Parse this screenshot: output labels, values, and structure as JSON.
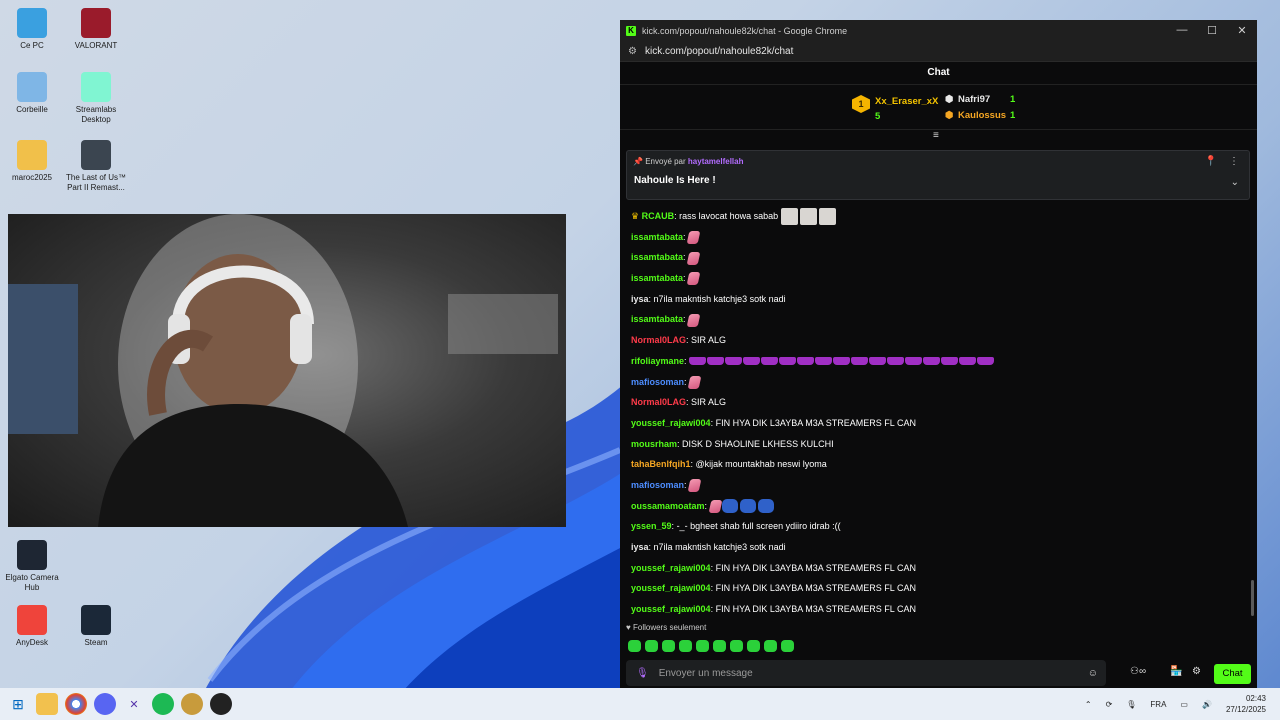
{
  "desktop": {
    "icons": [
      {
        "label": "Ce PC",
        "icon": "computer-icon",
        "color": "#3aa0e0"
      },
      {
        "label": "VALORANT",
        "icon": "valorant-icon",
        "color": "#9a1b2b"
      },
      {
        "label": "Corbeille",
        "icon": "recycle-bin-icon",
        "color": "#7fb6e6"
      },
      {
        "label": "Streamlabs Desktop",
        "icon": "streamlabs-icon",
        "color": "#80f5d2"
      },
      {
        "label": "maroc2025",
        "icon": "folder-icon",
        "color": "#f1c04a"
      },
      {
        "label": "The Last of Us™ Part II Remast...",
        "icon": "game-icon",
        "color": "#3b4550"
      },
      {
        "label": "Elgato Camera Hub",
        "icon": "elgato-icon",
        "color": "#1e2633"
      },
      {
        "label": "AnyDesk",
        "icon": "anydesk-icon",
        "color": "#ef443b"
      },
      {
        "label": "Steam",
        "icon": "steam-icon",
        "color": "#1b2838"
      }
    ]
  },
  "browser": {
    "title": "kick.com/popout/nahoule82k/chat - Google Chrome",
    "url": "kick.com/popout/nahoule82k/chat"
  },
  "chat": {
    "header": "Chat",
    "leaderboard": {
      "rank": "1",
      "first": {
        "name": "Xx_Eraser_xX",
        "count": "5"
      },
      "second": {
        "name": "Nafri97",
        "count": "1"
      },
      "third": {
        "name": "Kaulossus",
        "count": "1"
      }
    },
    "pinned": {
      "sent_by": "Envoyé par",
      "user": "haytamelfellah",
      "message": "Nahoule Is Here !"
    },
    "messages": [
      {
        "user": "RCAUB",
        "color": "#53fc18",
        "text": "rass lavocat howa sabab",
        "emotes": "pic3",
        "badge": "crown"
      },
      {
        "user": "issamtabata",
        "color": "#53fc18",
        "text": "",
        "emotes": "brush1"
      },
      {
        "user": "issamtabata",
        "color": "#53fc18",
        "text": "",
        "emotes": "brush1"
      },
      {
        "user": "issamtabata",
        "color": "#53fc18",
        "text": "",
        "emotes": "brush1"
      },
      {
        "user": "iysa",
        "color": "#e8e8e8",
        "text": "n7ila makntish katchje3 sotk nadi",
        "emotes": ""
      },
      {
        "user": "issamtabata",
        "color": "#53fc18",
        "text": "",
        "emotes": "brush1"
      },
      {
        "user": "Normal0LAG",
        "color": "#ff3b4a",
        "text": "SIR ALG",
        "emotes": ""
      },
      {
        "user": "rifoliaymane",
        "color": "#53fc18",
        "text": "",
        "emotes": "bars17"
      },
      {
        "user": "mafiosoman",
        "color": "#4d8dff",
        "text": "",
        "emotes": "brush1"
      },
      {
        "user": "Normal0LAG",
        "color": "#ff3b4a",
        "text": "SIR ALG",
        "emotes": ""
      },
      {
        "user": "youssef_rajawi004",
        "color": "#53fc18",
        "text": "FIN HYA DIK L3AYBA M3A STREAMERS FL CAN",
        "emotes": ""
      },
      {
        "user": "mousrham",
        "color": "#53fc18",
        "text": "DISK D SHAOLINE LKHESS KULCHI",
        "emotes": ""
      },
      {
        "user": "tahaBenlfqih1",
        "color": "#f5a623",
        "text": "@kijak mountakhab neswi lyoma",
        "emotes": ""
      },
      {
        "user": "mafiosoman",
        "color": "#4d8dff",
        "text": "",
        "emotes": "brush1"
      },
      {
        "user": "oussamamoatam",
        "color": "#53fc18",
        "text": "",
        "emotes": "blue4"
      },
      {
        "user": "yssen_59",
        "color": "#53fc18",
        "text": "-_- bgheet shab full screen ydiiro idrab :((",
        "emotes": ""
      },
      {
        "user": "iysa",
        "color": "#e8e8e8",
        "text": "n7ila makntish katchje3 sotk nadi",
        "emotes": ""
      },
      {
        "user": "youssef_rajawi004",
        "color": "#53fc18",
        "text": "FIN HYA DIK L3AYBA M3A STREAMERS FL CAN",
        "emotes": ""
      },
      {
        "user": "youssef_rajawi004",
        "color": "#53fc18",
        "text": "FIN HYA DIK L3AYBA M3A STREAMERS FL CAN",
        "emotes": ""
      },
      {
        "user": "youssef_rajawi004",
        "color": "#53fc18",
        "text": "FIN HYA DIK L3AYBA M3A STREAMERS FL CAN",
        "emotes": ""
      }
    ],
    "followers_only": "Followers seulement",
    "input_placeholder": "Envoyer un message",
    "send_label": "Chat"
  },
  "taskbar": {
    "lang": "FRA",
    "time": "02:43",
    "date": "27/12/2025"
  },
  "colors": {
    "kick_green": "#53fc18"
  }
}
